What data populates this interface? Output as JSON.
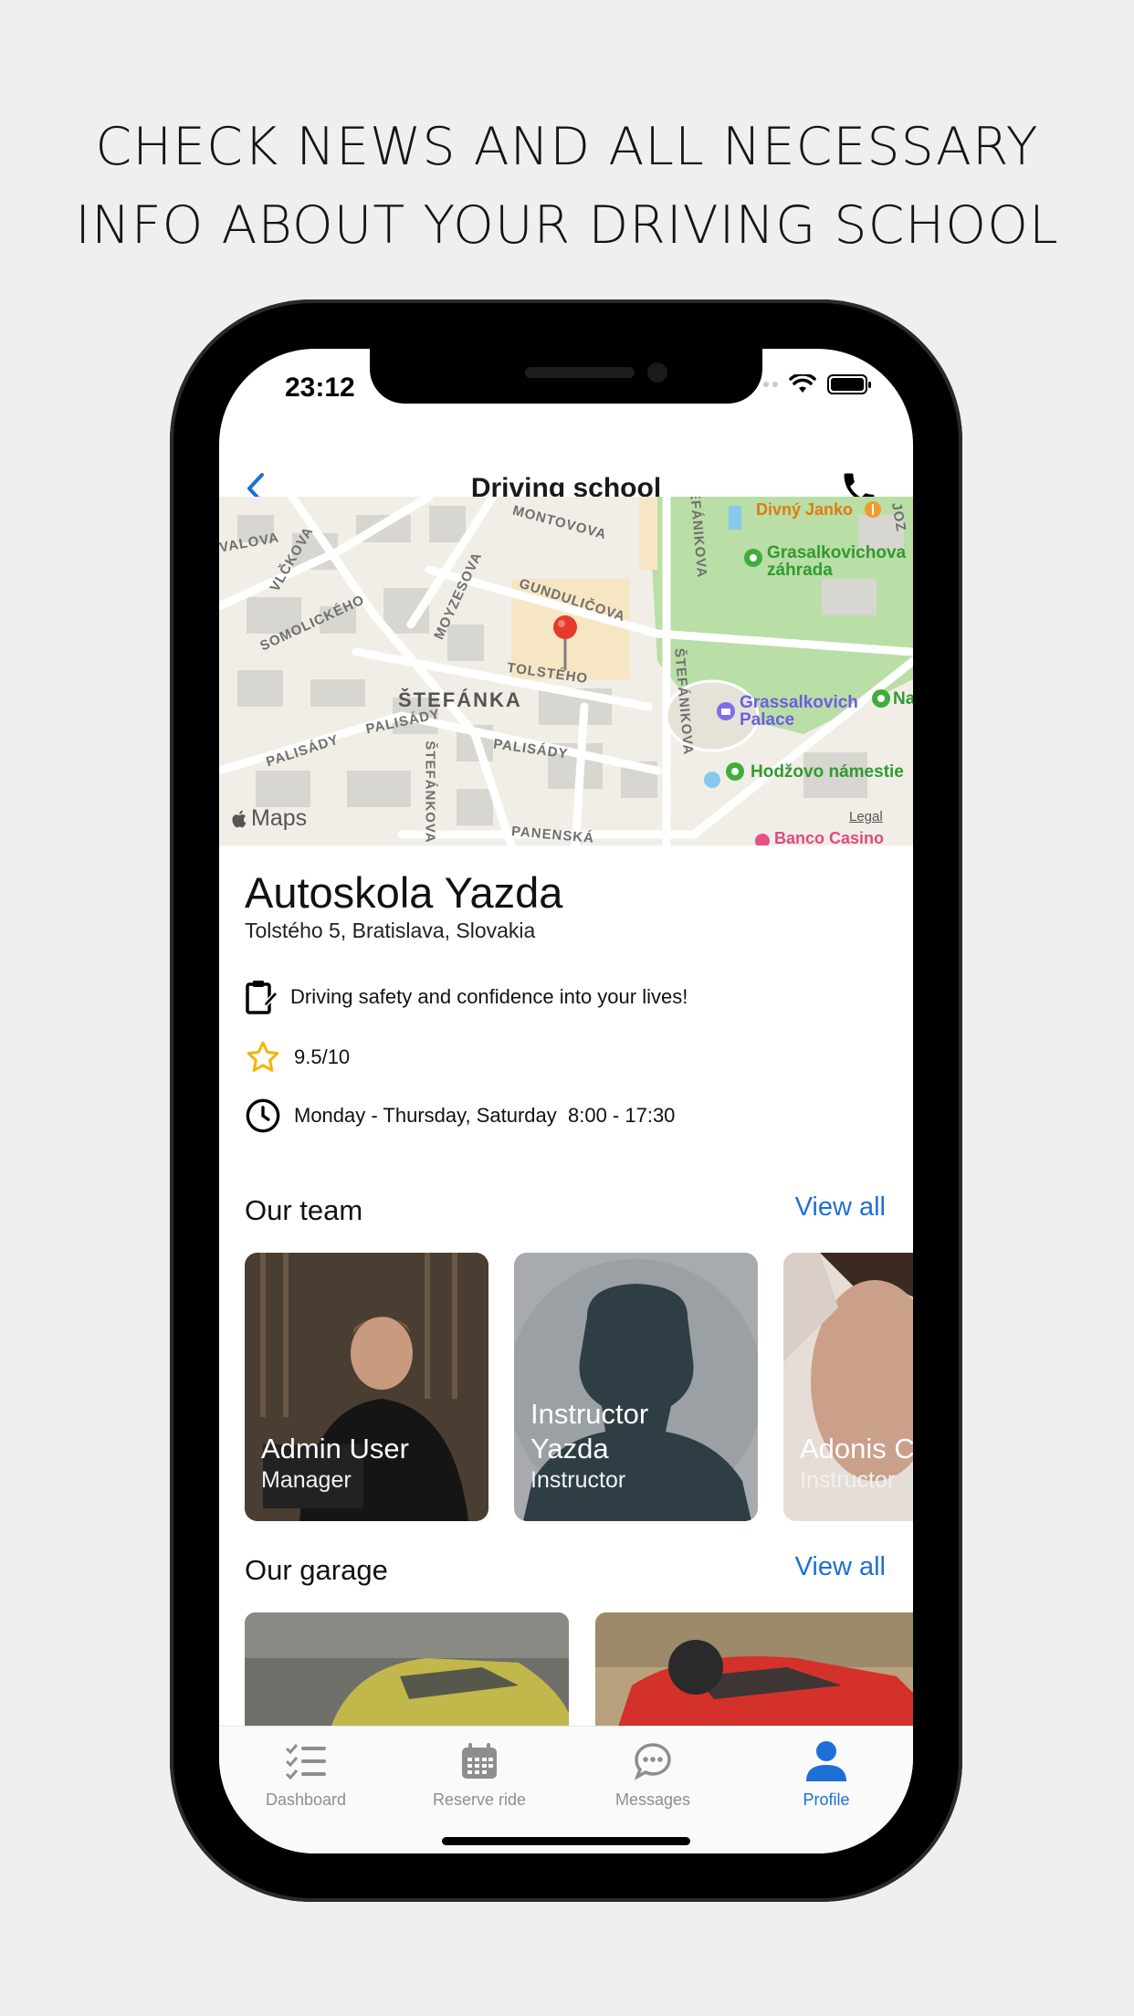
{
  "headline": {
    "line1": "CHECK NEWS AND ALL NECESSARY",
    "line2": "INFO ABOUT YOUR DRIVING SCHOOL"
  },
  "status_bar": {
    "time": "23:12"
  },
  "nav": {
    "title": "Driving school",
    "back_icon": "chevron-left-icon",
    "call_icon": "phone-icon"
  },
  "map": {
    "streets": [
      "VLČKOVA",
      "VALOVA",
      "SOMOLICKÉHO",
      "MOYZESOVA",
      "GUNDULIČOVA",
      "MONTOVOVA",
      "TOLSTÉHO",
      "PALISÁDY",
      "PALISÁDY",
      "PALISÁDY",
      "ŠTEFÁNIKOVA",
      "ŠTEFÁNIKOVA",
      "ŠTEFÁNKOVA",
      "PANENSKÁ",
      "JOZ"
    ],
    "district": "ŠTEFÁNKA",
    "pois": {
      "divny_janko": "Divný Janko",
      "garden_line1": "Grasalkovichova",
      "garden_line2": "záhrada",
      "palace_line1": "Grassalkovich",
      "palace_line2": "Palace",
      "square": "Hodžovo námestie",
      "casino": "Banco Casino",
      "na": "Na"
    },
    "attribution": "Maps",
    "legal": "Legal"
  },
  "school": {
    "name": "Autoskola Yazda",
    "address": "Tolstého 5, Bratislava, Slovakia",
    "motto": "Driving safety and confidence into your lives!",
    "rating": "9.5/10",
    "hours": "Monday - Thursday, Saturday  8:00 - 17:30"
  },
  "team": {
    "title": "Our team",
    "view_all": "View all",
    "members": [
      {
        "name": "Admin User",
        "role": "Manager"
      },
      {
        "name": "Instructor Yazda",
        "role": "Instructor"
      },
      {
        "name": "Adonis C",
        "role": "Instructor"
      }
    ]
  },
  "garage": {
    "title": "Our garage",
    "view_all": "View all"
  },
  "tabs": [
    {
      "label": "Dashboard",
      "icon": "checklist-icon"
    },
    {
      "label": "Reserve ride",
      "icon": "calendar-icon"
    },
    {
      "label": "Messages",
      "icon": "chat-bubble-icon"
    },
    {
      "label": "Profile",
      "icon": "person-icon",
      "active": true
    }
  ],
  "colors": {
    "accent": "#1d6fd6",
    "pin": "#e33b2e",
    "park": "#b9dea6",
    "star": "#f5b400"
  }
}
